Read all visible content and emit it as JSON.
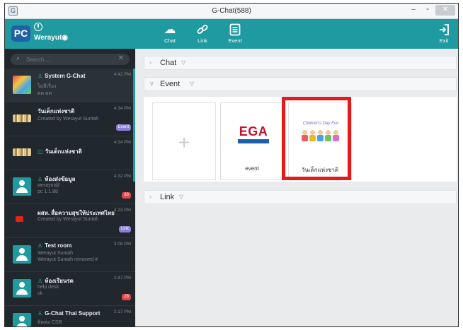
{
  "window": {
    "title": "G-Chat(588)",
    "minimize": "–",
    "maximize": "▫",
    "close": "✕",
    "app_icon": "G"
  },
  "header": {
    "logo": "PC",
    "username": "Werayut◉",
    "nav": [
      {
        "label": "Chat",
        "icon": "chat-bubbles-icon",
        "glyph": "☁"
      },
      {
        "label": "Link",
        "icon": "link-icon",
        "glyph": "🔗"
      },
      {
        "label": "Event",
        "icon": "event-list-icon",
        "glyph": "▤"
      }
    ],
    "exit": {
      "label": "Exit",
      "icon": "exit-icon",
      "glyph": "⇥"
    },
    "accent_color": "#1f9aa0"
  },
  "sidebar": {
    "search_placeholder": "Search ...",
    "search_clear": "✕",
    "conversations": [
      {
        "name": "System G-Chat",
        "line1": "ไม่มีเรื่อง",
        "line2": "ดด ตต",
        "time": "4:42 PM",
        "person_glyph": "♙"
      },
      {
        "name": "วันเด็กแห่งชาติ",
        "line1": "Created by Werayut Suntah",
        "time": "4:34 PM",
        "badge": "Event"
      },
      {
        "name": "วันเด็กแห่งชาติ",
        "time": "4:34 PM",
        "pre_glyph": "◫"
      },
      {
        "name": "ห้องส่งข้อมูล",
        "line1": "werayut@",
        "line2": "pc 1.1.88",
        "time": "4:32 PM",
        "badge": "83",
        "person_glyph": "♙"
      },
      {
        "name": "ผสห. สื่อความสุขให้ประเทศไทย",
        "line1": "Created by Werayut Suntah",
        "time": "4:23 PM",
        "badge": "Link"
      },
      {
        "name": "Test room",
        "line1": "Werayut Suntah",
        "line2": "Werayut Suntah removed #",
        "time": "3:08 PM",
        "person_glyph": "♙"
      },
      {
        "name": "ห้องเรียนรด",
        "line1": "help desk",
        "line2": "ok",
        "time": "2:47 PM",
        "badge": "28",
        "person_glyph": "♙"
      },
      {
        "name": "G-Chat Thai Support",
        "line1": "ติดต่อ CSR",
        "time": "2:17 PM",
        "person_glyph": "♙"
      }
    ]
  },
  "main": {
    "sections": [
      {
        "label": "Chat",
        "expanded": false
      },
      {
        "label": "Event",
        "expanded": true
      },
      {
        "label": "Link",
        "expanded": false
      }
    ],
    "chevron_collapsed": "›",
    "chevron_expanded": "∨",
    "filter_glyph": "▽",
    "add_glyph": "+",
    "events": [
      {
        "name": "event",
        "logo_text": "EGA",
        "logo_sub": ""
      },
      {
        "name": "วันเด็กแห่งชาติ",
        "logo_script": "Children's Day Fun",
        "selected": true
      }
    ],
    "highlight_color": "#e31b1b"
  }
}
